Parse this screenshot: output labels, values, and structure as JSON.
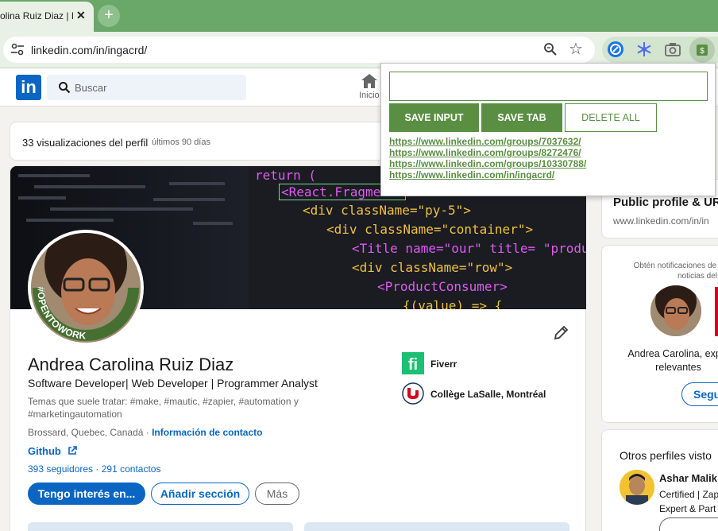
{
  "browser": {
    "tab_title": "olina Ruiz Diaz | L",
    "close_glyph": "✕",
    "new_tab_glyph": "+",
    "url": "linkedin.com/in/ingacrd/",
    "star_glyph": "☆"
  },
  "linkedin": {
    "logo": "in",
    "search_placeholder": "Buscar",
    "nav_home": "Inicio"
  },
  "profile": {
    "views": "33 visualizaciones del perfil",
    "views_period": "últimos 90 días",
    "otw_badge": "#OPENTOWORK",
    "name": "Andrea Carolina Ruiz Diaz",
    "headline": "Software Developer| Web Developer | Programmer Analyst",
    "topics": "Temas que suele tratar: #make, #mautic, #zapier, #automation y #marketingautomation",
    "location": "Brossard, Quebec, Canadá",
    "separator": " · ",
    "contact_info": "Información de contacto",
    "github": "Github",
    "followers": "393 seguidores",
    "connections": "291 contactos",
    "btn_interest": "Tengo interés en...",
    "btn_add_section": "Añadir sección",
    "btn_more": "Más",
    "experience": [
      {
        "name": "Fiverr",
        "logo_color": "#1dbf73"
      },
      {
        "name": "Collège LaSalle, Montréal",
        "logo_color": "#d6001c"
      }
    ],
    "banner_code": [
      "return (",
      "<React.Fragment>",
      "<div className=\"py-5\">",
      "<div className=\"container\">",
      "<Title name=\"our\" title= \"product",
      "<div className=\"row\">",
      "<ProductConsumer>",
      "{(value) => {"
    ]
  },
  "sidebar": {
    "public_profile_title": "Public profile & UR",
    "public_profile_url": "www.linkedin.com/in/in",
    "notif_text_line1": "Obtén notificaciones de a",
    "notif_text_line2": "noticias del",
    "ad_name_line1": "Andrea Carolina, explo",
    "ad_name_line2": "relevantes",
    "ad_button": "Segu",
    "other_profiles_title": "Otros perfiles visto",
    "person_name": "Ashar Malik",
    "person_line1": "Certified | Zap",
    "person_line2": "Expert & Part"
  },
  "extension_popup": {
    "input_value": "",
    "save_input": "SAVE INPUT",
    "save_tab": "SAVE TAB",
    "delete_all": "DELETE ALL",
    "links": [
      "https://www.linkedin.com/groups/7037632/",
      "https://www.linkedin.com/groups/8272476/",
      "https://www.linkedin.com/groups/10330788/",
      "https://www.linkedin.com/in/ingacrd/"
    ],
    "accent_color": "#5a8f43"
  },
  "colors": {
    "linkedin_blue": "#0a66c2",
    "browser_frame": "#6aa86a"
  }
}
